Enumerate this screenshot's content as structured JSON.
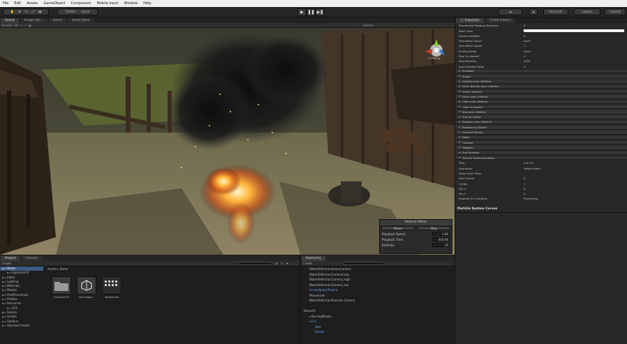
{
  "menu": {
    "items": [
      "File",
      "Edit",
      "Assets",
      "GameObject",
      "Component",
      "Mobile Input",
      "Window",
      "Help"
    ]
  },
  "toolbar": {
    "pivot_label": "Center",
    "local_label": "Local",
    "account_label": "Account",
    "layers_label": "Layers",
    "layout_label": "Layout"
  },
  "scene_tabs": [
    "Scene",
    "Image Vie...",
    "Game",
    "Asset Store"
  ],
  "scene_toolbar": {
    "shading": "Shaded",
    "gizmos_label": "Gizmos"
  },
  "gizmo": {
    "projection": "< Persp",
    "axis_x": "x",
    "axis_y": "y",
    "axis_z": "z"
  },
  "particle_panel": {
    "title": "Particle Effect",
    "pause_label": "Pause",
    "stop_label": "Stop",
    "rows": [
      {
        "label": "Playback Speed",
        "value": "1.00"
      },
      {
        "label": "Playback Time",
        "value": "450.06"
      },
      {
        "label": "Particles",
        "value": "25"
      }
    ]
  },
  "inspector": {
    "tabs": [
      "Inspector",
      "Collab History"
    ],
    "rows": [
      {
        "label": "Randomize Rotation Direction",
        "value": "0",
        "kind": "prop"
      },
      {
        "label": "Start Color",
        "value": "",
        "kind": "color"
      },
      {
        "label": "Gravity Modifier",
        "value": "0",
        "kind": "prop"
      },
      {
        "label": "Simulation Space",
        "value": "Local",
        "kind": "prop"
      },
      {
        "label": "Simulation Speed",
        "value": "1",
        "kind": "prop"
      },
      {
        "label": "Scaling Mode",
        "value": "Local",
        "kind": "prop"
      },
      {
        "label": "Play On Awake*",
        "value": "✔",
        "kind": "prop"
      },
      {
        "label": "Max Particles",
        "value": "1000",
        "kind": "prop"
      },
      {
        "label": "Auto Random Seed",
        "value": "✔",
        "kind": "prop"
      },
      {
        "label": "Emission",
        "value": "",
        "kind": "mod"
      },
      {
        "label": "Shape",
        "value": "",
        "kind": "mod"
      },
      {
        "label": "Velocity over Lifetime",
        "value": "",
        "kind": "mod"
      },
      {
        "label": "Limit Velocity over Lifetime",
        "value": "",
        "kind": "mod"
      },
      {
        "label": "Inherit Velocity",
        "value": "",
        "kind": "mod"
      },
      {
        "label": "Force over Lifetime",
        "value": "",
        "kind": "mod"
      },
      {
        "label": "Color over Lifetime",
        "value": "",
        "kind": "mod"
      },
      {
        "label": "Color by Speed",
        "value": "",
        "kind": "mod"
      },
      {
        "label": "Size over Lifetime",
        "value": "",
        "kind": "mod"
      },
      {
        "label": "Size by Speed",
        "value": "",
        "kind": "mod"
      },
      {
        "label": "Rotation over Lifetime",
        "value": "",
        "kind": "mod"
      },
      {
        "label": "Rotation by Speed",
        "value": "",
        "kind": "mod"
      },
      {
        "label": "External Forces",
        "value": "",
        "kind": "mod"
      },
      {
        "label": "Noise",
        "value": "",
        "kind": "mod"
      },
      {
        "label": "Collision",
        "value": "",
        "kind": "mod"
      },
      {
        "label": "Triggers",
        "value": "",
        "kind": "mod"
      },
      {
        "label": "Sub Emitters",
        "value": "",
        "kind": "mod"
      },
      {
        "label": "Texture Sheet Animation",
        "value": "",
        "kind": "mod"
      },
      {
        "label": "Tiles",
        "value": "X 8        Y 8",
        "kind": "prop"
      },
      {
        "label": "Animation",
        "value": "Whole Sheet",
        "kind": "prop"
      },
      {
        "label": "Frame over Time",
        "value": "",
        "kind": "prop"
      },
      {
        "label": "Start Frame",
        "value": "0",
        "kind": "prop"
      },
      {
        "label": "Cycles",
        "value": "1",
        "kind": "prop"
      },
      {
        "label": "Flip U",
        "value": "0",
        "kind": "prop"
      },
      {
        "label": "Flip V",
        "value": "0",
        "kind": "prop"
      },
      {
        "label": "Enabled UV Channels",
        "value": "Everything",
        "kind": "prop"
      }
    ],
    "footer": "Particle System Curves"
  },
  "project": {
    "tabs": [
      "Project",
      "Console"
    ],
    "create_label": "Create",
    "breadcrumb": "Assets ▸ Demo",
    "tree": [
      "Demo",
      "Explosion03",
      "Editor",
      "Lighting",
      "Materials",
      "Models",
      "PostProcessing",
      "Prefabs",
      "Resources",
      "VFX",
      "Scenes",
      "Scripts",
      "Shaders",
      "Standard Assets"
    ],
    "assets": [
      {
        "label": "Explosion03",
        "icon": "folder-icon"
      },
      {
        "label": "Hot Image...",
        "icon": "unity-scene-icon"
      },
      {
        "label": "Workaholia",
        "icon": "grid-asset-icon"
      }
    ]
  },
  "hierarchy": {
    "tab": "Hierarchy",
    "create_label": "Create",
    "search_label": "All",
    "items": [
      {
        "label": "WaterReflectionSceneCamera",
        "indent": 1,
        "blue": false
      },
      {
        "label": "WaterReflectionCameraLoop",
        "indent": 1,
        "blue": false
      },
      {
        "label": "WaterReflectionCamera_high",
        "indent": 1,
        "blue": false
      },
      {
        "label": "WaterReflectionCamera_low",
        "indent": 1,
        "blue": false
      },
      {
        "label": "ScreenSpaceTrackre",
        "indent": 1,
        "blue": true
      },
      {
        "label": "MouseLook",
        "indent": 1,
        "blue": false
      },
      {
        "label": "WaterReflectionPrecrete Camera",
        "indent": 1,
        "blue": false
      },
      {
        "label": "",
        "indent": 0,
        "blue": false
      },
      {
        "label": "DemoFX",
        "indent": 0,
        "blue": false
      },
      {
        "label": "▸ BurningPlanks",
        "indent": 1,
        "blue": false
      },
      {
        "label": "▾ Fire",
        "indent": 1,
        "blue": true
      },
      {
        "label": "Side",
        "indent": 2,
        "blue": true
      },
      {
        "label": "Smoke",
        "indent": 2,
        "blue": true
      }
    ]
  }
}
